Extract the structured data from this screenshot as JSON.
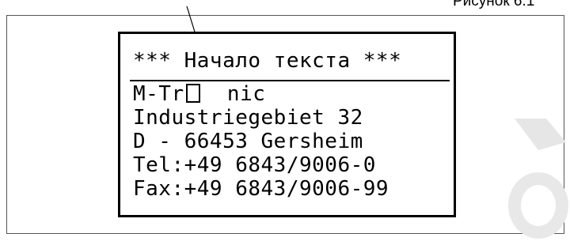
{
  "caption": "Рисунок 6.1",
  "display": {
    "header": "*** Начало текста ***",
    "company_prefix": "M-Tr",
    "company_suffix": "  nic",
    "lines": [
      "Industriegebiet 32",
      "D - 66453 Gersheim",
      "Tel:+49 6843/9006-0",
      "Fax:+49 6843/9006-99"
    ]
  }
}
